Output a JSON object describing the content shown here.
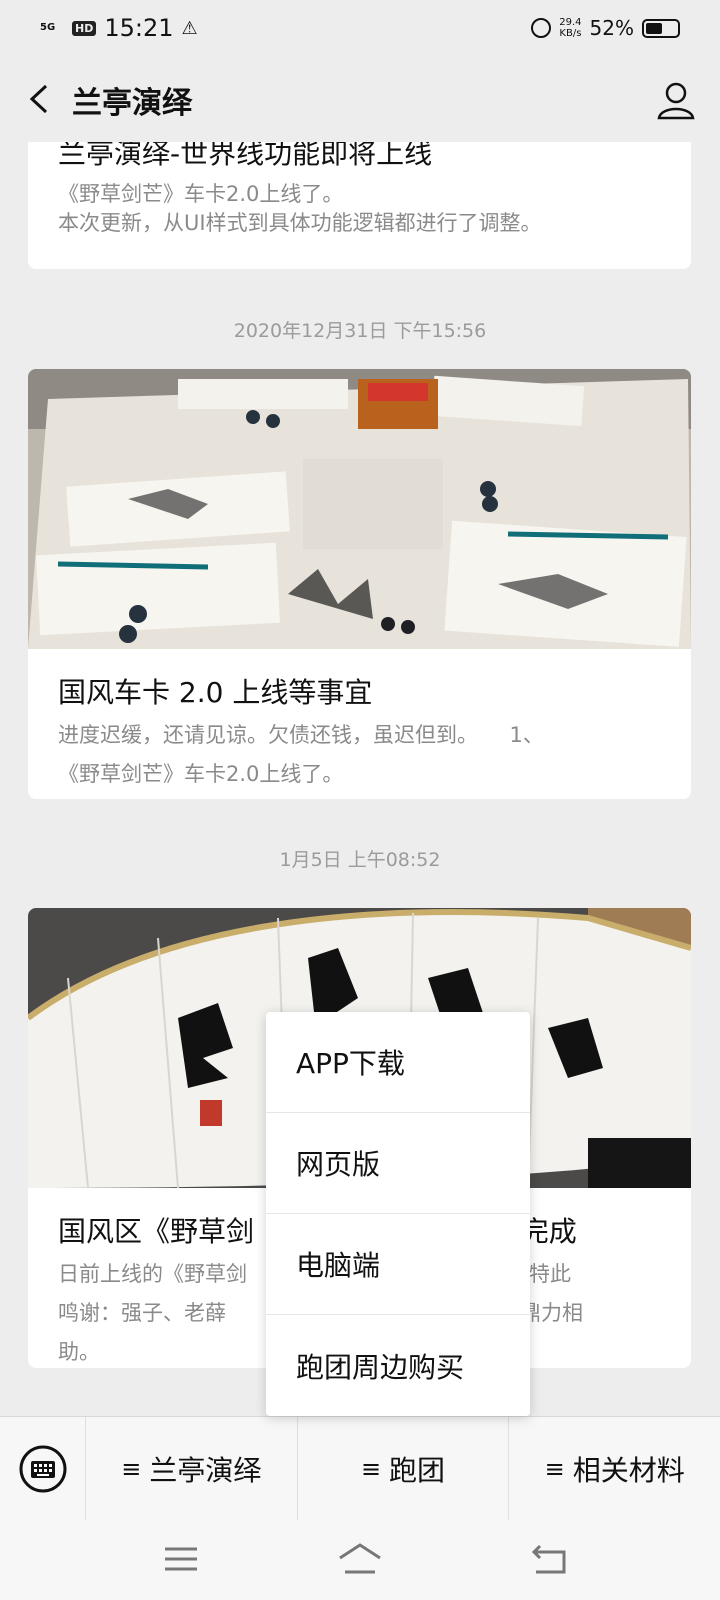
{
  "status_bar": {
    "network": "5G",
    "hd": "HD",
    "time": "15:21",
    "speed_value": "29.4",
    "speed_unit": "KB/s",
    "battery_percent": "52%",
    "battery_level": 0.52
  },
  "header": {
    "title": "兰亭演绎",
    "back_icon": "chevron-left",
    "profile_icon": "person-outline"
  },
  "feed": [
    {
      "title": "兰亭演绎-世界线功能即将上线",
      "desc_line1": "《野草剑芒》车卡2.0上线了。",
      "desc_line2": "本次更新，从UI样式到具体功能逻辑都进行了调整。"
    },
    {
      "timestamp": "2020年12月31日 下午15:56",
      "title": "国风车卡 2.0 上线等事宜",
      "desc_line1": "进度迟缓，还请见谅。欠债还钱，虽迟但到。　　1、",
      "desc_line2": "《野草剑芒》车卡2.0上线了。"
    },
    {
      "timestamp": "1月5日 上午08:52",
      "title_left": "国风区《野草剑",
      "title_right": "g 完成",
      "desc_line1_left": "日前上线的《野草剑",
      "desc_line1_right": "成。特此",
      "desc_line2_left": "鸣谢：强子、老薛",
      "desc_line2_right": "士的鼎力相",
      "desc_line3": "助。"
    }
  ],
  "popup_menu": {
    "items": [
      "APP下载",
      "网页版",
      "电脑端",
      "跑团周边购买"
    ]
  },
  "menu_bar": {
    "keyboard_icon": "keyboard",
    "glyph": "≡",
    "items": [
      "兰亭演绎",
      "跑团",
      "相关材料"
    ]
  },
  "colors": {
    "background": "#ededed",
    "card": "#ffffff",
    "muted_text": "#8a8a8a"
  }
}
